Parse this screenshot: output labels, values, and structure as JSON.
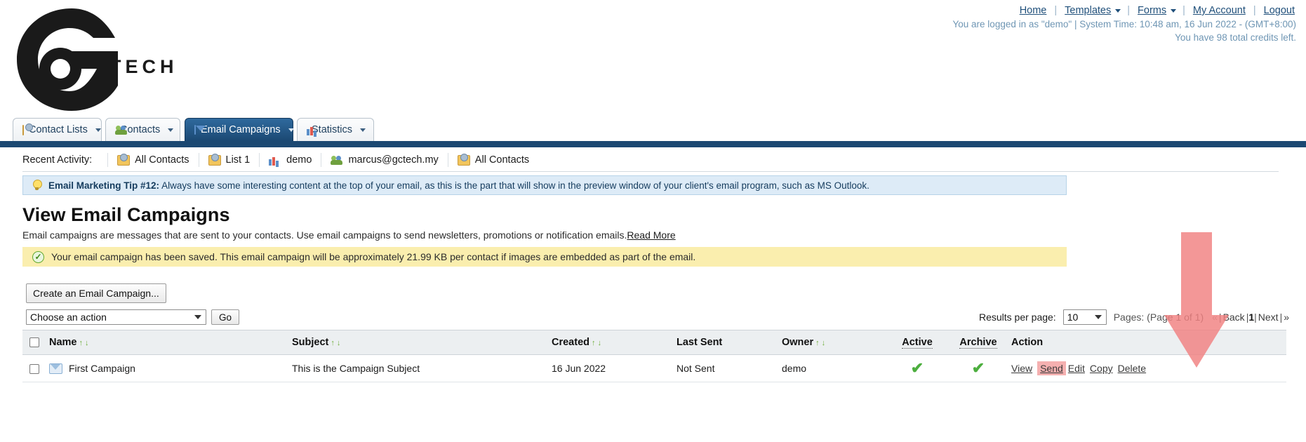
{
  "topbar": {
    "nav": [
      {
        "label": "Home",
        "caret": false
      },
      {
        "label": "Templates",
        "caret": true
      },
      {
        "label": "Forms",
        "caret": true
      },
      {
        "label": "My Account",
        "caret": false
      },
      {
        "label": "Logout",
        "caret": false
      }
    ],
    "separator": "|",
    "session_line": "You are logged in as \"demo\" | System Time: 10:48 am, 16 Jun 2022 - (GMT+8:00)",
    "credits_line": "You have 98 total credits left."
  },
  "logo": {
    "mark": "g-logo-mark",
    "wordmark": "TECH"
  },
  "tabs": [
    {
      "label": "Contact Lists",
      "icon": "folder-icon",
      "caret": true,
      "active": false
    },
    {
      "label": "Contacts",
      "icon": "people-icon",
      "caret": true,
      "active": false
    },
    {
      "label": "Email Campaigns",
      "icon": "mail-icon",
      "caret": true,
      "active": true
    },
    {
      "label": "Statistics",
      "icon": "chart-icon",
      "caret": true,
      "active": false
    }
  ],
  "recent_activity": {
    "label": "Recent Activity:",
    "items": [
      {
        "label": "All Contacts",
        "icon": "folder-icon"
      },
      {
        "label": "List 1",
        "icon": "folder-icon"
      },
      {
        "label": "demo",
        "icon": "chart-icon"
      },
      {
        "label": "marcus@gctech.my",
        "icon": "people-icon"
      },
      {
        "label": "All Contacts",
        "icon": "folder-icon"
      }
    ]
  },
  "tip": {
    "icon": "lightbulb-icon",
    "title": "Email Marketing Tip #12:",
    "body": " Always have some interesting content at the top of your email, as this is the part that will show in the preview window of your client's email program, such as MS Outlook."
  },
  "page": {
    "title": "View Email Campaigns",
    "description": "Email campaigns are messages that are sent to your contacts. Use email campaigns to send newsletters, promotions or notification emails.",
    "read_more": "Read More"
  },
  "saved_notice": {
    "icon": "check-circle-icon",
    "text": "Your email campaign has been saved. This email campaign will be approximately 21.99 KB per contact if images are embedded as part of the email."
  },
  "toolbar": {
    "create_button": "Create an Email Campaign...",
    "action_select_value": "Choose an action",
    "go_button": "Go"
  },
  "pagination": {
    "results_per_page_label": "Results per page:",
    "results_per_page_value": "10",
    "pages_label": "Pages: (Page 1 of 1)",
    "first": "«",
    "back": "Back",
    "current": "1",
    "next": "Next",
    "last": "»",
    "sep": "|"
  },
  "table": {
    "columns": [
      {
        "key": "select",
        "label": "",
        "sortable": false
      },
      {
        "key": "name",
        "label": "Name",
        "sortable": true
      },
      {
        "key": "subject",
        "label": "Subject",
        "sortable": true
      },
      {
        "key": "created",
        "label": "Created",
        "sortable": true
      },
      {
        "key": "last_sent",
        "label": "Last Sent",
        "sortable": false
      },
      {
        "key": "owner",
        "label": "Owner",
        "sortable": true
      },
      {
        "key": "active",
        "label": "Active",
        "sortable": false,
        "tooltip": true
      },
      {
        "key": "archive",
        "label": "Archive",
        "sortable": false,
        "tooltip": true
      },
      {
        "key": "action",
        "label": "Action",
        "sortable": false
      }
    ],
    "sort_up": "↑",
    "sort_down": "↓",
    "rows": [
      {
        "name": "First Campaign",
        "subject": "This is the Campaign Subject",
        "created": "16 Jun 2022",
        "last_sent": "Not Sent",
        "owner": "demo",
        "active": "✔",
        "archive": "✔",
        "icon": "envelope-icon",
        "actions": [
          {
            "label": "View",
            "highlighted": false
          },
          {
            "label": "Send",
            "highlighted": true
          },
          {
            "label": "Edit",
            "highlighted": false
          },
          {
            "label": "Copy",
            "highlighted": false
          },
          {
            "label": "Delete",
            "highlighted": false
          }
        ]
      }
    ]
  },
  "annotation": {
    "type": "down-arrow",
    "color": "#f08080",
    "target": "Send"
  },
  "colors": {
    "accent_blue": "#1b4872",
    "tip_bg": "#ddebf7",
    "saved_bg": "#faeeae",
    "highlight_pink": "#f5b0b0",
    "check_green": "#4cae3e"
  }
}
